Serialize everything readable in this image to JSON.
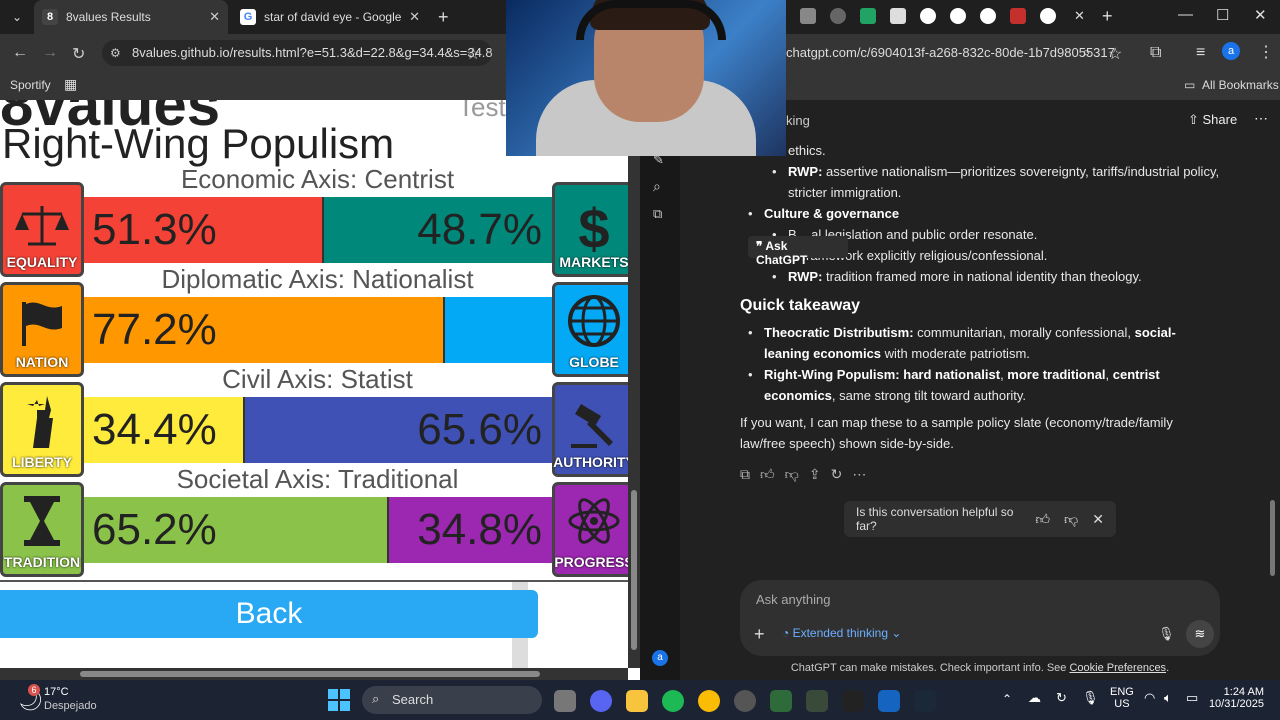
{
  "left_browser": {
    "tabs": [
      {
        "label": "8values Results",
        "favicon": "8"
      },
      {
        "label": "star of david eye - Google Sear",
        "favicon": "G"
      }
    ],
    "url": "8values.github.io/results.html?e=51.3&d=22.8&g=34.4&s=34.8",
    "bookmarks": [
      "Sportify"
    ],
    "page": {
      "site_title": "8values",
      "test_label": "Test",
      "ideology": "Right-Wing Populism",
      "back_label": "Back",
      "axes": [
        {
          "title": "Economic Axis: Centrist",
          "left_label": "EQUALITY",
          "right_label": "MARKETS",
          "left_value": "51.3%",
          "right_value": "48.7%",
          "left_fraction": 0.513,
          "left_color": "#f44336",
          "right_color": "#00897b",
          "left_icon": "scales-icon",
          "right_icon": "dollar-icon"
        },
        {
          "title": "Diplomatic Axis: Nationalist",
          "left_label": "NATION",
          "right_label": "GLOBE",
          "left_value": "77.2%",
          "right_value": "",
          "left_fraction": 0.772,
          "left_color": "#ff9800",
          "right_color": "#03a9f4",
          "left_icon": "flag-icon",
          "right_icon": "globe-icon"
        },
        {
          "title": "Civil Axis: Statist",
          "left_label": "LIBERTY",
          "right_label": "AUTHORITY",
          "left_value": "34.4%",
          "right_value": "65.6%",
          "left_fraction": 0.344,
          "left_color": "#ffeb3b",
          "right_color": "#3f51b5",
          "left_icon": "statue-of-liberty-icon",
          "right_icon": "gavel-icon"
        },
        {
          "title": "Societal Axis: Traditional",
          "left_label": "TRADITION",
          "right_label": "PROGRESS",
          "left_value": "65.2%",
          "right_value": "34.8%",
          "left_fraction": 0.652,
          "left_color": "#8bc34a",
          "right_color": "#9c27b0",
          "left_icon": "hourglass-icon",
          "right_icon": "atom-icon"
        }
      ]
    }
  },
  "right_browser": {
    "url": "chatgpt.com/c/6904013f-a268-832c-80de-1b7d98055317",
    "bookmarks_label": "All Bookmarks",
    "header_partial": "king",
    "share_label": "Share",
    "ask_popup": "Ask ChatGPT",
    "content": {
      "line_ethics": "ethics.",
      "rwp_econ_label": "RWP:",
      "rwp_econ_text": " assertive nationalism—prioritizes sovereignty, tariffs/industrial policy, stricter immigration.",
      "culture_label": "Culture & governance",
      "culture_line1": "B... al legislation and public order resonate.",
      "culture_line2": "... framework explicitly religious/confessional.",
      "rwp_culture_label": "RWP:",
      "rwp_culture_text": " tradition framed more in national identity than theology.",
      "takeaway_heading": "Quick takeaway",
      "td_label": "Theocratic Distributism:",
      "td_text": " communitarian, morally confessional, ",
      "td_bold2": "social-leaning economics",
      "td_text2": " with moderate patriotism.",
      "rwp_label": "Right-Wing Populism:",
      "rwp_b1": "hard nationalist",
      "rwp_sep1": ", ",
      "rwp_b2": "more traditional",
      "rwp_sep2": ", ",
      "rwp_b3": "centrist economics",
      "rwp_text": ", same strong tilt toward authority.",
      "closing": "If you want, I can map these to a sample policy slate (economy/trade/family law/free speech) shown side-by-side."
    },
    "helpful_prompt": "Is this conversation helpful so far?",
    "input_placeholder": "Ask anything",
    "extended_thinking": "Extended thinking",
    "disclaimer": "ChatGPT can make mistakes. Check important info. See ",
    "disclaimer_link": "Cookie Preferences",
    "disclaimer_end": "."
  },
  "taskbar": {
    "temperature": "17°C",
    "weather": "Despejado",
    "search_label": "Search",
    "language": "ENG",
    "region": "US",
    "time": "1:24 AM",
    "date": "10/31/2025",
    "weather_badge": "6"
  }
}
